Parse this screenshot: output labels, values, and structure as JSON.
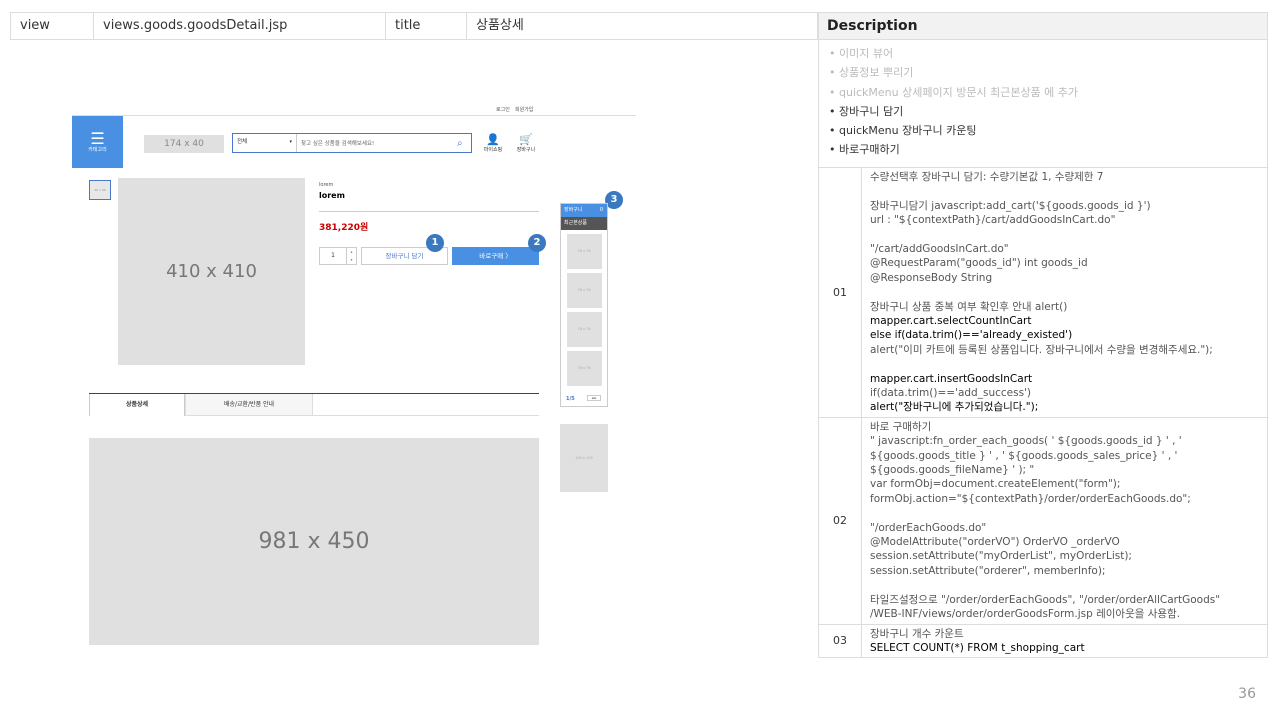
{
  "header": {
    "view_label": "view",
    "view_value": "views.goods.goodsDetail.jsp",
    "title_label": "title",
    "title_value": "상품상세",
    "description_label": "Description"
  },
  "bullets": [
    {
      "text": "이미지 뷰어",
      "state": "grey"
    },
    {
      "text": "상품정보 뿌리기",
      "state": "grey"
    },
    {
      "text": "quickMenu 상세페이지 방문시 최근본상품 에 추가",
      "state": "grey"
    },
    {
      "text": "장바구니 담기",
      "state": "dark"
    },
    {
      "text": "quickMenu 장바구니 카운팅",
      "state": "dark"
    },
    {
      "text": "바로구매하기",
      "state": "dark"
    }
  ],
  "rows": [
    {
      "num": "01",
      "lines": [
        {
          "t": "수량선택후 장바구니 담기: 수량기본값 1, 수량제한 7",
          "k": false
        },
        {
          "t": "",
          "k": false
        },
        {
          "t": "장바구니담기 javascript:add_cart('${goods.goods_id }')",
          "k": false
        },
        {
          "t": "url : \"${contextPath}/cart/addGoodsInCart.do\"",
          "k": false
        },
        {
          "t": "",
          "k": false
        },
        {
          "t": "\"/cart/addGoodsInCart.do\"",
          "k": false
        },
        {
          "t": "@RequestParam(\"goods_id\") int goods_id",
          "k": false
        },
        {
          "t": "@ResponseBody String",
          "k": false
        },
        {
          "t": "",
          "k": false
        },
        {
          "t": "장바구니 상품 중복 여부 확인후 안내 alert()",
          "k": false
        },
        {
          "t": "mapper.cart.selectCountInCart",
          "k": true
        },
        {
          "t": "else if(data.trim()=='already_existed')",
          "k": true
        },
        {
          "t": "alert(\"이미 카트에 등록된 상품입니다. 장바구니에서 수량을 변경해주세요.\");",
          "k": false
        },
        {
          "t": "",
          "k": false
        },
        {
          "t": "mapper.cart.insertGoodsInCart",
          "k": true
        },
        {
          "t": "if(data.trim()=='add_success')",
          "k": false
        },
        {
          "t": "alert(\"장바구니에 추가되었습니다.\");",
          "k": true
        }
      ]
    },
    {
      "num": "02",
      "lines": [
        {
          "t": "바로 구매하기",
          "k": false
        },
        {
          "t": " \" javascript:fn_order_each_goods( ' ${goods.goods_id } ' , '",
          "k": false
        },
        {
          "t": "${goods.goods_title } ' , ' ${goods.goods_sales_price} ' , '",
          "k": false
        },
        {
          "t": "${goods.goods_fileName} ' ); \"",
          "k": false
        },
        {
          "t": "var formObj=document.createElement(\"form\");",
          "k": false
        },
        {
          "t": "formObj.action=\"${contextPath}/order/orderEachGoods.do\";",
          "k": false
        },
        {
          "t": "",
          "k": false
        },
        {
          "t": "\"/orderEachGoods.do\"",
          "k": false
        },
        {
          "t": "@ModelAttribute(\"orderVO\") OrderVO _orderVO",
          "k": false
        },
        {
          "t": "session.setAttribute(\"myOrderList\", myOrderList);",
          "k": false
        },
        {
          "t": "session.setAttribute(\"orderer\", memberInfo);",
          "k": false
        },
        {
          "t": "",
          "k": false
        },
        {
          "t": "타일즈설정으로 \"/order/orderEachGoods\", \"/order/orderAllCartGoods\"",
          "k": false
        },
        {
          "t": "/WEB-INF/views/order/orderGoodsForm.jsp 레이아웃을 사용함.",
          "k": false
        }
      ]
    },
    {
      "num": "03",
      "lines": [
        {
          "t": "장바구니 개수 카운트",
          "k": false
        },
        {
          "t": "SELECT COUNT(*) FROM t_shopping_cart",
          "k": true
        }
      ]
    }
  ],
  "wireframe": {
    "top_links": [
      "로그인",
      "회원가입"
    ],
    "category_label": "카테고리",
    "logo_placeholder": "174 x 40",
    "search_select": "전체",
    "search_placeholder": "찾고 싶은 상품을 검색해보세요!",
    "icon_mypage": "마이쇼핑",
    "icon_cart": "장바구니",
    "thumb_label": "96 x 96",
    "main_image": "410 x 410",
    "product_small": "lorem",
    "product_name": "lorem",
    "price": "381,220원",
    "qty": "1",
    "cart_button": "장바구니 담기",
    "buy_button": "바로구매 〉",
    "badges": [
      "1",
      "2",
      "3"
    ],
    "quick_cart": "장바구니",
    "quick_cart_count": "0",
    "quick_recent": "최근본상품",
    "quick_thumbs": [
      "76 x 76",
      "76 x 76",
      "76 x 76",
      "76 x 76"
    ],
    "quick_page": "1/5",
    "quick_nav": "◂ ▸",
    "banner": "100 x 150",
    "tab_detail": "상품상세",
    "tab_delivery": "배송/교환/반품 안내",
    "detail_image": "981 x 450"
  },
  "page_number": "36",
  "colors": {
    "accent": "#4a90e2",
    "price": "#cc0000"
  }
}
